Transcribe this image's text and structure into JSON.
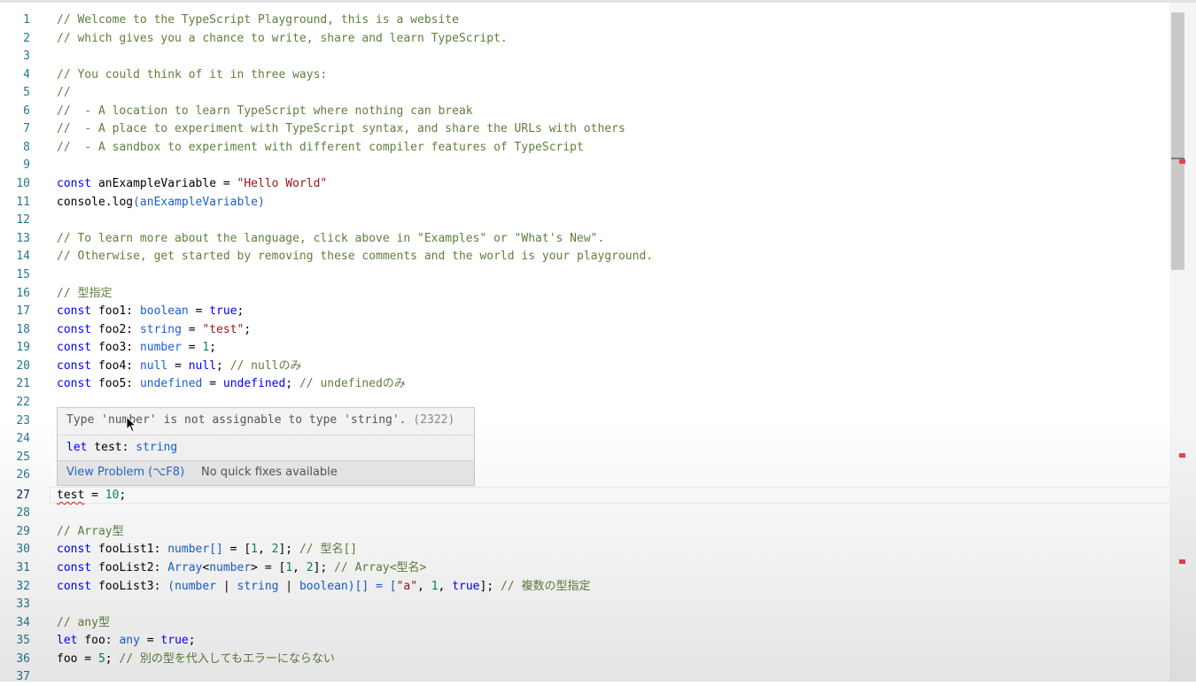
{
  "editor": {
    "active_line": 27,
    "line_numbers": [
      "1",
      "2",
      "3",
      "4",
      "5",
      "6",
      "7",
      "8",
      "9",
      "10",
      "11",
      "12",
      "13",
      "14",
      "15",
      "16",
      "17",
      "18",
      "19",
      "20",
      "21",
      "22",
      "23",
      "24",
      "25",
      "26",
      "27",
      "28",
      "29",
      "30",
      "31",
      "32",
      "33",
      "34",
      "35",
      "36",
      "37"
    ],
    "lines": {
      "l1": "// Welcome to the TypeScript Playground, this is a website",
      "l2": "// which gives you a chance to write, share and learn TypeScript.",
      "l4": "// You could think of it in three ways:",
      "l5": "//",
      "l6": "//  - A location to learn TypeScript where nothing can break",
      "l7": "//  - A place to experiment with TypeScript syntax, and share the URLs with others",
      "l8": "//  - A sandbox to experiment with different compiler features of TypeScript",
      "l10": {
        "kw": "const",
        "name": " anExampleVariable = ",
        "str": "\"Hello World\""
      },
      "l11": {
        "a": "console.log",
        "b": "(anExampleVariable)"
      },
      "l13": "// To learn more about the language, click above in \"Examples\" or \"What's New\".",
      "l14": "// Otherwise, get started by removing these comments and the world is your playground.",
      "l16": "// 型指定",
      "l17": {
        "kw": "const",
        "name": " foo1: ",
        "type": "boolean",
        "eq": " = ",
        "val": "true",
        "end": ";"
      },
      "l18": {
        "kw": "const",
        "name": " foo2: ",
        "type": "string",
        "eq": " = ",
        "val": "\"test\"",
        "end": ";"
      },
      "l19": {
        "kw": "const",
        "name": " foo3: ",
        "type": "number",
        "eq": " = ",
        "val": "1",
        "end": ";"
      },
      "l20": {
        "kw": "const",
        "name": " foo4: ",
        "type": "null",
        "eq": " = ",
        "val": "null",
        "end": "; ",
        "cmt": "// nullのみ"
      },
      "l21": {
        "kw": "const",
        "name": " foo5: ",
        "type": "undefined",
        "eq": " = ",
        "val": "undefined",
        "end": "; ",
        "cmt": "// undefinedのみ"
      },
      "l27": {
        "var": "test",
        "eq": " = ",
        "val": "10",
        "end": ";"
      },
      "l29": "// Array型",
      "l30": {
        "kw": "const",
        "name": " fooList1: ",
        "type": "number[]",
        "eq": " = [",
        "v1": "1",
        "sep": ", ",
        "v2": "2",
        "end": "]; ",
        "cmt": "// 型名[]"
      },
      "l31": {
        "kw": "const",
        "name": " fooList2: ",
        "type": "Array",
        "lt": "<",
        "t2": "number",
        "gt": ">",
        "eq": " = [",
        "v1": "1",
        "sep": ", ",
        "v2": "2",
        "end": "]; ",
        "cmt": "// Array<型名>"
      },
      "l32": {
        "kw": "const",
        "name": " fooList3: ",
        "p1": "(",
        "t1": "number",
        "bar1": " | ",
        "t2": "string",
        "bar2": " | ",
        "t3": "boolean",
        "p2": ")[] = [",
        "s": "\"a\"",
        "c1": ", ",
        "n": "1",
        "c2": ", ",
        "b": "true",
        "end": "]; ",
        "cmt": "// 複数の型指定"
      },
      "l34": "// any型",
      "l35": {
        "kw": "let",
        "name": " foo: ",
        "type": "any",
        "eq": " = ",
        "val": "true",
        "end": ";"
      },
      "l36": {
        "name": "foo = ",
        "val": "5",
        "end": "; ",
        "cmt": "// 別の型を代入してもエラーにならない"
      }
    }
  },
  "hover": {
    "message": "Type 'number' is not assignable to type 'string'.",
    "code": "(2322)",
    "decl_kw": "let",
    "decl_name": " test: ",
    "decl_type": "string",
    "view_problem": "View Problem (⌥F8)",
    "no_quick_fixes": "No quick fixes available"
  },
  "colors": {
    "comment": "#5f7f3c",
    "keyword": "#0000ff",
    "type": "#1a5fd0",
    "string": "#a31515",
    "number": "#098658",
    "error": "#e51400",
    "line_number": "#237893"
  }
}
